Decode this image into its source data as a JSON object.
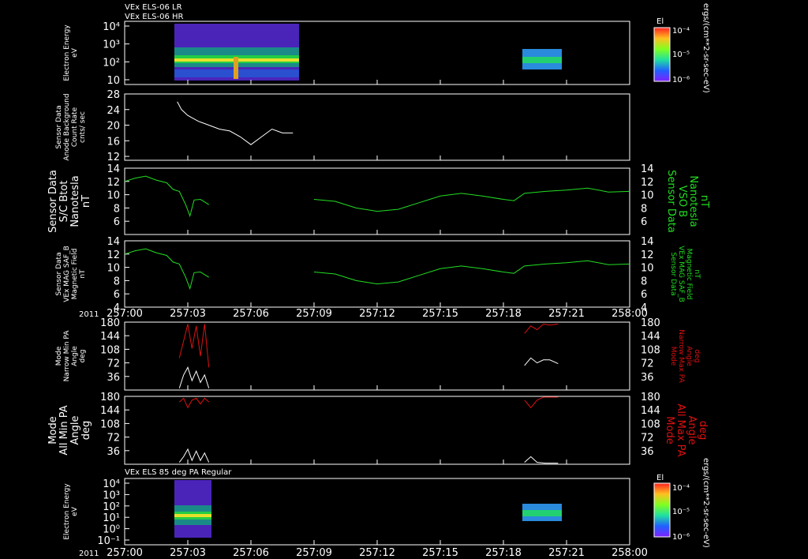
{
  "header": {
    "line1": "VEx ELS-06 LR",
    "line2": "VEx ELS-06 HR"
  },
  "footer_title": "VEx ELS 85 deg PA Regular",
  "year": "2011",
  "colorbar": {
    "title": "El",
    "units": "ergs/(cm**2-sr-sec-eV)",
    "labels": [
      "10⁻⁴",
      "10⁻⁵",
      "10⁻⁶"
    ]
  },
  "x_ticks": [
    "257:00",
    "257:03",
    "257:06",
    "257:09",
    "257:12",
    "257:15",
    "257:18",
    "257:21",
    "258:00"
  ],
  "colors": {
    "white": "#ffffff",
    "green": "#22dd22",
    "red": "#dd1111"
  },
  "chart_data": [
    {
      "id": "spec1",
      "type": "heatmap",
      "ylabel": "Electron Energy\neV",
      "yticks": [
        "10⁴",
        "10³",
        "10²",
        "10"
      ],
      "ylog": true,
      "ylim": [
        1,
        10000
      ],
      "segments": [
        {
          "x": [
            "257:02.5",
            "257:08"
          ]
        },
        {
          "x": [
            "257:18.9",
            "257:20.6"
          ]
        }
      ]
    },
    {
      "id": "counts",
      "type": "line",
      "ylabel": "Sensor Data\nAnode Background\nCount Rate\ncnts/ sec",
      "ylim": [
        11,
        28
      ],
      "yticks": [
        28,
        24,
        20,
        16,
        12
      ],
      "series": [
        {
          "color": "white",
          "points": [
            [
              2.5,
              26
            ],
            [
              2.7,
              24
            ],
            [
              3,
              22.5
            ],
            [
              3.5,
              21
            ],
            [
              4,
              20
            ],
            [
              4.5,
              19
            ],
            [
              5,
              18.5
            ],
            [
              5.5,
              17
            ],
            [
              6,
              15
            ],
            [
              6.5,
              17
            ],
            [
              7,
              19
            ],
            [
              7.5,
              18
            ],
            [
              8,
              18
            ]
          ]
        }
      ]
    },
    {
      "id": "bmag1",
      "type": "line",
      "ylabel": "Sensor Data\nS/C Btot\nNanotesla\nnT",
      "ylabel_right": "Sensor Data\nVSO B\nNanotesla\nnT",
      "ylim": [
        4,
        14
      ],
      "yticks": [
        14,
        12,
        10,
        8,
        6
      ],
      "series": [
        {
          "color": "green",
          "points": [
            [
              0,
              12
            ],
            [
              0.5,
              12.5
            ],
            [
              1,
              12.8
            ],
            [
              1.5,
              12.2
            ],
            [
              2,
              11.8
            ],
            [
              2.3,
              10.8
            ],
            [
              2.6,
              10.5
            ],
            [
              2.9,
              8.5
            ],
            [
              3.1,
              6.8
            ],
            [
              3.3,
              9.2
            ],
            [
              3.6,
              9.3
            ],
            [
              4,
              8.5
            ]
          ]
        },
        {
          "color": "green",
          "points": [
            [
              9,
              9.3
            ],
            [
              10,
              9
            ],
            [
              11,
              8
            ],
            [
              12,
              7.5
            ],
            [
              13,
              7.8
            ],
            [
              14,
              8.8
            ],
            [
              15,
              9.8
            ],
            [
              16,
              10.2
            ],
            [
              17,
              9.8
            ],
            [
              18,
              9.3
            ],
            [
              18.5,
              9.1
            ],
            [
              19,
              10.2
            ],
            [
              20,
              10.5
            ],
            [
              21,
              10.7
            ],
            [
              22,
              11
            ],
            [
              23,
              10.4
            ],
            [
              24,
              10.5
            ]
          ]
        }
      ]
    },
    {
      "id": "bmag2",
      "type": "line",
      "ylabel": "Sensor Data\nVEx MAG SAF_B\nMagnetic Field\nnT",
      "ylabel_right": "Sensor Data\nVEx MAG SAF_B\nMagnetic Field\nnT",
      "ylim": [
        4,
        14
      ],
      "yticks": [
        14,
        12,
        10,
        8,
        6,
        4
      ],
      "series": [
        {
          "color": "green",
          "points": [
            [
              0,
              12
            ],
            [
              0.5,
              12.5
            ],
            [
              1,
              12.8
            ],
            [
              1.5,
              12.2
            ],
            [
              2,
              11.8
            ],
            [
              2.3,
              10.8
            ],
            [
              2.6,
              10.5
            ],
            [
              2.9,
              8.5
            ],
            [
              3.1,
              6.8
            ],
            [
              3.3,
              9.2
            ],
            [
              3.6,
              9.3
            ],
            [
              4,
              8.5
            ]
          ]
        },
        {
          "color": "green",
          "points": [
            [
              9,
              9.3
            ],
            [
              10,
              9
            ],
            [
              11,
              8
            ],
            [
              12,
              7.5
            ],
            [
              13,
              7.8
            ],
            [
              14,
              8.8
            ],
            [
              15,
              9.8
            ],
            [
              16,
              10.2
            ],
            [
              17,
              9.8
            ],
            [
              18,
              9.3
            ],
            [
              18.5,
              9.1
            ],
            [
              19,
              10.2
            ],
            [
              20,
              10.5
            ],
            [
              21,
              10.7
            ],
            [
              22,
              11
            ],
            [
              23,
              10.4
            ],
            [
              24,
              10.5
            ]
          ]
        }
      ]
    },
    {
      "id": "narrowpa",
      "type": "line",
      "ylabel": "Mode\nNarrow Min PA\nAngle\ndeg",
      "ylabel_right": "Mode\nNarrow Max PA\nAngle\ndeg",
      "ylim": [
        0,
        180
      ],
      "yticks": [
        180,
        144,
        108,
        72,
        36
      ],
      "series": [
        {
          "color": "red",
          "points": [
            [
              2.6,
              85
            ],
            [
              2.8,
              130
            ],
            [
              3,
              175
            ],
            [
              3.2,
              110
            ],
            [
              3.4,
              170
            ],
            [
              3.6,
              90
            ],
            [
              3.8,
              175
            ],
            [
              4,
              60
            ]
          ]
        },
        {
          "color": "white",
          "points": [
            [
              2.6,
              5
            ],
            [
              2.8,
              40
            ],
            [
              3,
              60
            ],
            [
              3.2,
              25
            ],
            [
              3.4,
              50
            ],
            [
              3.6,
              20
            ],
            [
              3.8,
              40
            ],
            [
              4,
              5
            ]
          ]
        },
        {
          "color": "red",
          "points": [
            [
              19,
              150
            ],
            [
              19.3,
              170
            ],
            [
              19.6,
              160
            ],
            [
              19.9,
              175
            ],
            [
              20.2,
              172
            ],
            [
              20.6,
              175
            ]
          ]
        },
        {
          "color": "white",
          "points": [
            [
              19,
              65
            ],
            [
              19.3,
              85
            ],
            [
              19.6,
              72
            ],
            [
              19.9,
              80
            ],
            [
              20.2,
              80
            ],
            [
              20.6,
              70
            ]
          ]
        }
      ]
    },
    {
      "id": "allpa",
      "type": "line",
      "ylabel": "Mode\nAll Min PA\nAngle\ndeg",
      "ylabel_right": "Mode\nAll Max PA\nAngle\ndeg",
      "ylim": [
        0,
        180
      ],
      "yticks": [
        180,
        144,
        108,
        72,
        36
      ],
      "series": [
        {
          "color": "red",
          "points": [
            [
              2.6,
              165
            ],
            [
              2.8,
              175
            ],
            [
              3,
              150
            ],
            [
              3.2,
              170
            ],
            [
              3.4,
              175
            ],
            [
              3.6,
              160
            ],
            [
              3.8,
              175
            ],
            [
              4,
              165
            ]
          ]
        },
        {
          "color": "white",
          "points": [
            [
              2.6,
              5
            ],
            [
              2.8,
              20
            ],
            [
              3,
              40
            ],
            [
              3.2,
              10
            ],
            [
              3.4,
              35
            ],
            [
              3.6,
              10
            ],
            [
              3.8,
              30
            ],
            [
              4,
              5
            ]
          ]
        },
        {
          "color": "red",
          "points": [
            [
              19,
              170
            ],
            [
              19.3,
              150
            ],
            [
              19.6,
              170
            ],
            [
              19.9,
              178
            ],
            [
              20.6,
              178
            ]
          ]
        },
        {
          "color": "white",
          "points": [
            [
              19,
              5
            ],
            [
              19.3,
              20
            ],
            [
              19.6,
              5
            ],
            [
              20,
              3
            ],
            [
              20.6,
              3
            ]
          ]
        }
      ]
    },
    {
      "id": "spec2",
      "type": "heatmap",
      "ylabel": "Electron Energy\neV",
      "yticks": [
        "10⁴",
        "10³",
        "10²",
        "10¹",
        "10⁰",
        "10⁻¹"
      ],
      "ylog": true,
      "segments": [
        {
          "x": [
            "257:02.5",
            "257:04"
          ]
        },
        {
          "x": [
            "257:18.9",
            "257:20.6"
          ]
        }
      ]
    }
  ]
}
